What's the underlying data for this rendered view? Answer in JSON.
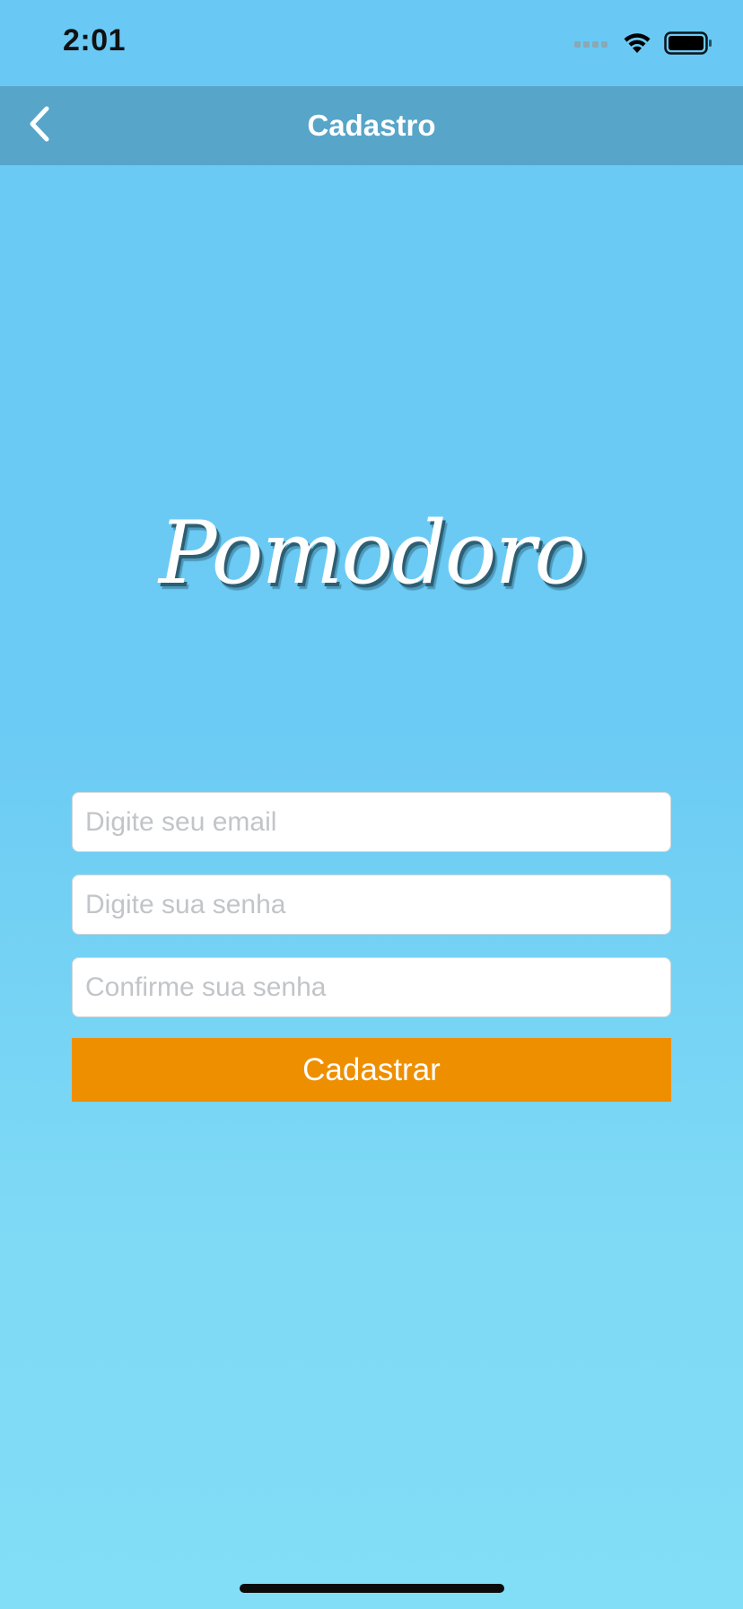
{
  "status_bar": {
    "time": "2:01",
    "icons": [
      "cellular-signal-icon",
      "wifi-icon",
      "battery-icon"
    ]
  },
  "nav_bar": {
    "back_icon": "chevron-left-icon",
    "title": "Cadastro"
  },
  "logo": {
    "text": "Pomodoro"
  },
  "form": {
    "email_placeholder": "Digite seu email",
    "email_value": "",
    "password_placeholder": "Digite sua senha",
    "password_value": "",
    "confirm_placeholder": "Confirme sua senha",
    "confirm_value": "",
    "submit_label": "Cadastrar"
  },
  "colors": {
    "background_top": "#69c9f4",
    "background_bottom": "#82def6",
    "nav_bar": "#57a5c9",
    "button": "#ee8f00",
    "text_on_accent": "#ffffff"
  }
}
